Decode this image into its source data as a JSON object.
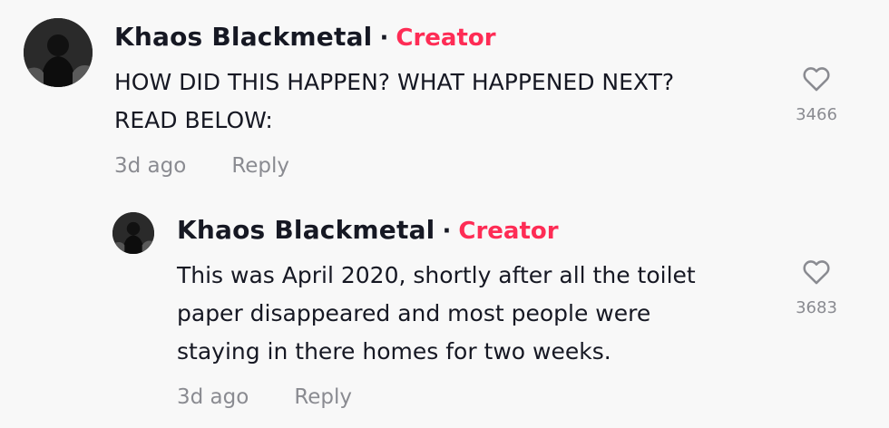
{
  "comment": {
    "author": "Khaos Blackmetal",
    "separator": "·",
    "badge": "Creator",
    "text_line1": "HOW DID THIS HAPPEN? WHAT HAPPENED NEXT?",
    "text_line2": "READ BELOW:",
    "time": "3d ago",
    "reply_label": "Reply",
    "likes": "3466"
  },
  "reply": {
    "author": "Khaos Blackmetal",
    "separator": "·",
    "badge": "Creator",
    "text_line1": "This was April 2020, shortly after all the toilet",
    "text_line2": "paper disappeared and most people were",
    "text_line3": "staying in there homes for two weeks.",
    "time": "3d ago",
    "reply_label": "Reply",
    "likes": "3683"
  },
  "colors": {
    "accent": "#fe2c55",
    "text": "#161823",
    "muted": "#8a8b91",
    "background": "#f8f8f8"
  },
  "icons": {
    "like": "heart-outline-icon"
  }
}
